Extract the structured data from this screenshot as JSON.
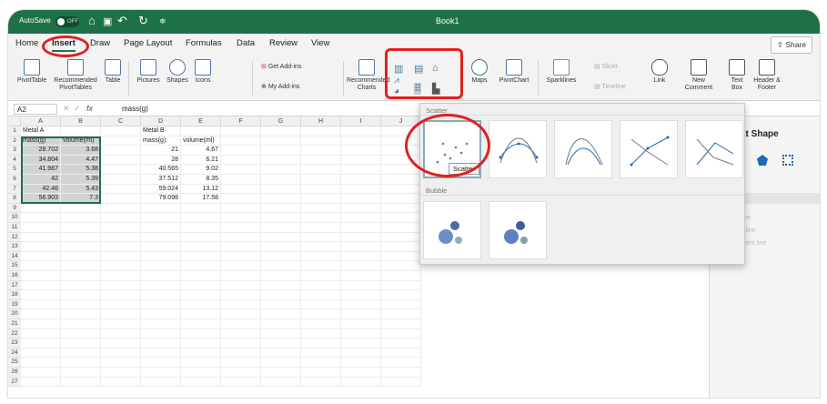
{
  "titlebar": {
    "autosave": "AutoSave",
    "toggle": "OFF",
    "title": "Book1"
  },
  "menu": {
    "items": [
      "Home",
      "Insert",
      "Draw",
      "Page Layout",
      "Formulas",
      "Data",
      "Review",
      "View"
    ],
    "share": "Share"
  },
  "ribbon": {
    "pivottable": "PivotTable",
    "recommended_pivottables": "Recommended PivotTables",
    "table": "Table",
    "pictures": "Pictures",
    "shapes": "Shapes",
    "icons": "Icons",
    "get_addins": "Get Add-ins",
    "my_addins": "My Add-ins",
    "recommended_charts": "Recommended Charts",
    "maps": "Maps",
    "pivotchart": "PivotChart",
    "sparklines": "Sparklines",
    "slicer": "Slicer",
    "timeline": "Timeline",
    "link": "Link",
    "new_comment": "New Comment",
    "text_box": "Text Box",
    "header_footer": "Header & Footer"
  },
  "formula_bar": {
    "cell": "A2",
    "fx": "fx",
    "content": "mass(g)"
  },
  "sheet": {
    "columns": [
      "A",
      "B",
      "C",
      "D",
      "E",
      "F",
      "G",
      "H",
      "I",
      "J"
    ],
    "rows": [
      "1",
      "2",
      "3",
      "4",
      "5",
      "6",
      "7",
      "8",
      "9",
      "10",
      "11",
      "12",
      "13",
      "14",
      "15",
      "16",
      "17",
      "18",
      "19",
      "20",
      "21",
      "22",
      "23",
      "24",
      "25",
      "26",
      "27"
    ],
    "metal_a": {
      "title": "Metal A",
      "headers": [
        "mass(g)",
        "volume(ml)"
      ],
      "mass": [
        "28.702",
        "34.804",
        "41.987",
        "42",
        "42.46",
        "56.903"
      ],
      "volume": [
        "3.68",
        "4.47",
        "5.38",
        "5.39",
        "5.43",
        "7.3"
      ]
    },
    "metal_b": {
      "title": "Metal B",
      "headers": [
        "mass(g)",
        "volume(ml)"
      ],
      "mass": [
        "21",
        "28",
        "40.565",
        "37.512",
        "59.024",
        "79.098"
      ],
      "volume": [
        "4.67",
        "6.21",
        "9.02",
        "8.35",
        "13.12",
        "17.58"
      ]
    }
  },
  "right_panel": {
    "title": "at Shape",
    "items": [
      "line",
      "d line",
      "ment line"
    ]
  },
  "chart_menu": {
    "scatter_label": "Scatter",
    "bubble_label": "Bubble",
    "tooltip": "Scatter"
  },
  "colors": {
    "excel_green": "#1e7145",
    "annotation_red": "#e02020"
  }
}
